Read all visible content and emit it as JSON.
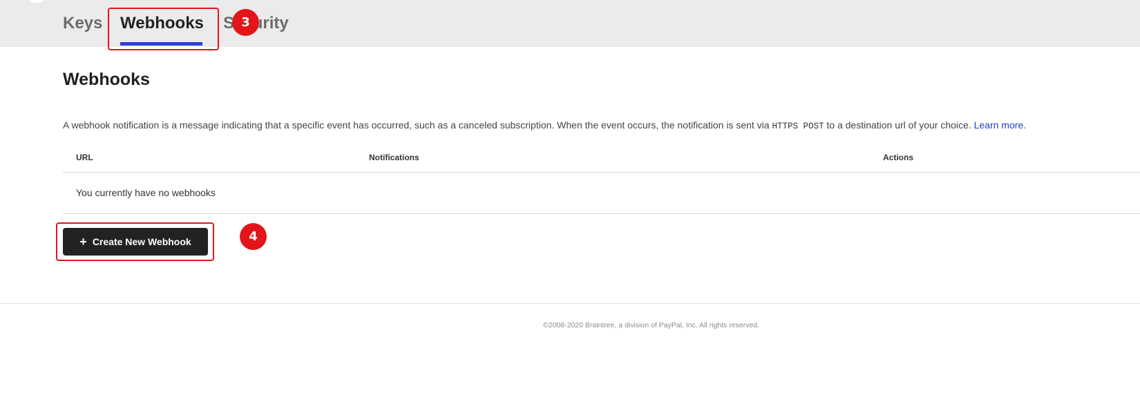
{
  "tabs": [
    {
      "label": "Keys",
      "active": false
    },
    {
      "label": "Webhooks",
      "active": true
    },
    {
      "label": "Security",
      "active": false
    }
  ],
  "callouts": [
    "3",
    "4"
  ],
  "page": {
    "title": "Webhooks",
    "description_before": "A webhook notification is a message indicating that a specific event has occurred, such as a canceled subscription. When the event occurs, the notification is sent via ",
    "description_code": "HTTPS POST",
    "description_after": " to a destination url of your choice. ",
    "learn_more": "Learn more."
  },
  "table": {
    "headers": [
      "URL",
      "Notifications",
      "Actions"
    ],
    "empty_message": "You currently have no webhooks"
  },
  "create_button": {
    "label": "Create New Webhook",
    "icon": "plus-icon"
  },
  "footer": "©2008-2020 Braintree, a division of PayPal, Inc. All rights reserved.",
  "colors": {
    "tab_underline": "#2f3fd6",
    "callout": "#e3151a",
    "button": "#222222",
    "link": "#1e3fcf"
  }
}
